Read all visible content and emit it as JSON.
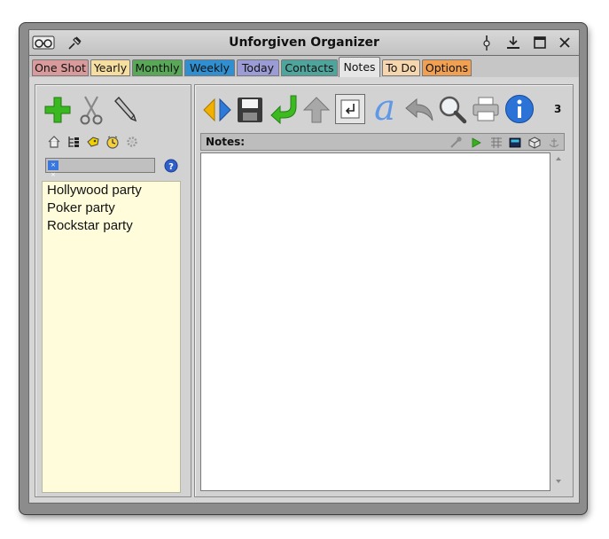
{
  "window": {
    "title": "Unforgiven Organizer"
  },
  "titlebar_icons": [
    "glasses-icon",
    "pin-icon",
    "thumbtack-icon",
    "minimize-icon",
    "maximize-icon",
    "close-icon"
  ],
  "tabs": [
    {
      "label": "One Shot",
      "color": "#d89a9a"
    },
    {
      "label": "Yearly",
      "color": "#f5dea0"
    },
    {
      "label": "Monthly",
      "color": "#58a858"
    },
    {
      "label": "Weekly",
      "color": "#2f8fd0"
    },
    {
      "label": "Today",
      "color": "#9b9bd6"
    },
    {
      "label": "Contacts",
      "color": "#4fa59c"
    },
    {
      "label": "Notes",
      "color": "#e6e6e6"
    },
    {
      "label": "To Do",
      "color": "#f6d6ae"
    },
    {
      "label": "Options",
      "color": "#f0a050"
    }
  ],
  "active_tab": "Notes",
  "left": {
    "toolbar": [
      "add-icon",
      "cut-icon",
      "edit-pencil-icon"
    ],
    "small_toolbar": [
      "home-icon",
      "tree-icon",
      "tag-icon",
      "clock-icon",
      "gear-icon"
    ],
    "search": {
      "value": ""
    },
    "help": "?",
    "notes": [
      "Hollywood party",
      "Poker party",
      "Rockstar party"
    ]
  },
  "right": {
    "toolbar": [
      "sync-arrows-icon",
      "save-disk-icon",
      "download-arrow-icon",
      "up-arrow-icon",
      "wrap-icon",
      "font-a-icon",
      "undo-icon",
      "magnifier-icon",
      "printer-icon",
      "info-icon"
    ],
    "count": "3",
    "notes_header": "Notes:",
    "header_icons": [
      "link-icon",
      "play-icon",
      "table-icon",
      "calculator-icon",
      "cube-icon",
      "anchor-icon"
    ]
  },
  "colors": {
    "list_bg": "#fffcdc",
    "window_frame": "#8c8c8c"
  }
}
